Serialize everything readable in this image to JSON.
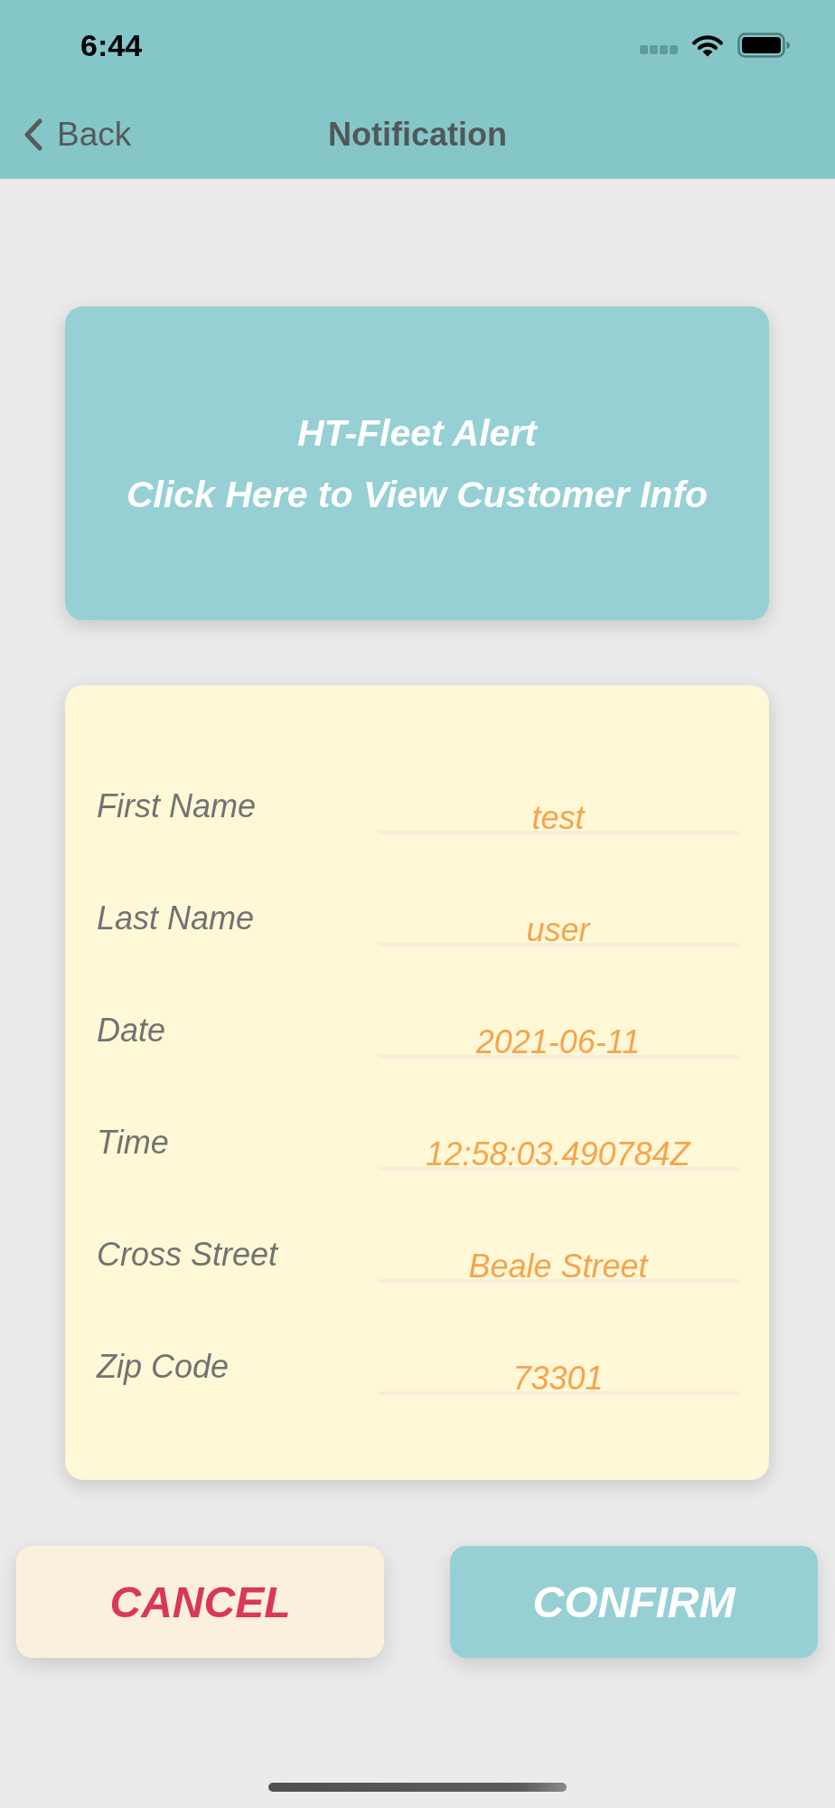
{
  "status_bar": {
    "time": "6:44"
  },
  "nav_bar": {
    "back_label": "Back",
    "title": "Notification"
  },
  "alert_card": {
    "lines": [
      "HT-Fleet Alert",
      "Click Here to View Customer Info"
    ]
  },
  "form": {
    "fields": [
      {
        "label": "First Name",
        "value": "test"
      },
      {
        "label": "Last Name",
        "value": "user"
      },
      {
        "label": "Date",
        "value": "2021-06-11"
      },
      {
        "label": "Time",
        "value": "12:58:03.490784Z"
      },
      {
        "label": "Cross Street",
        "value": "Beale Street"
      },
      {
        "label": "Zip Code",
        "value": "73301"
      }
    ]
  },
  "buttons": [
    {
      "label": "CANCEL",
      "kind": "cancel"
    },
    {
      "label": "CONFIRM",
      "kind": "confirm"
    }
  ]
}
